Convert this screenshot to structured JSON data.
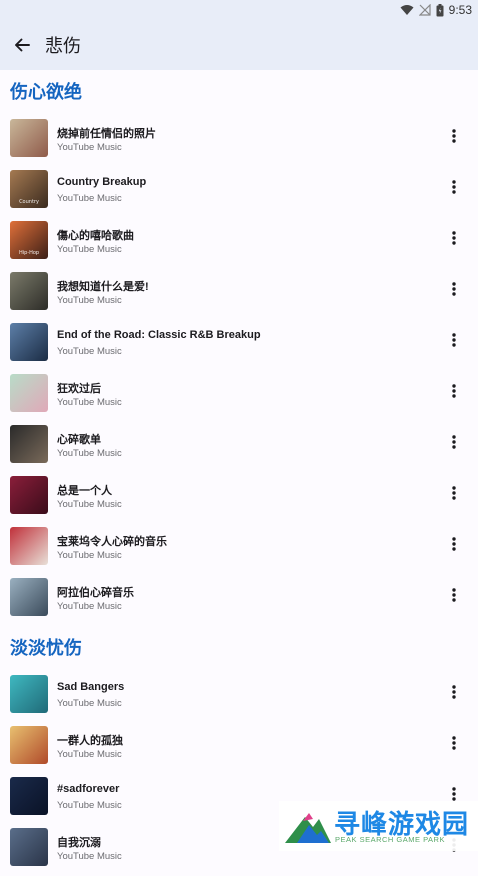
{
  "status": {
    "time": "9:53"
  },
  "header": {
    "title": "悲伤"
  },
  "sections": [
    {
      "title": "伤心欲绝",
      "items": [
        {
          "title": "烧掉前任情侣的照片",
          "subtitle": "YouTube Music",
          "thumb_caption": "",
          "colors": [
            "#c9b79a",
            "#8f5a4a"
          ]
        },
        {
          "title": "Country Breakup",
          "subtitle": "YouTube Music",
          "thumb_caption": "Country",
          "colors": [
            "#a57a52",
            "#3a2a1e"
          ]
        },
        {
          "title": "傷心的嘻哈歌曲",
          "subtitle": "YouTube Music",
          "thumb_caption": "Hip-Hop",
          "colors": [
            "#e0703a",
            "#3b1e16"
          ]
        },
        {
          "title": "我想知道什么是爱!",
          "subtitle": "YouTube Music",
          "thumb_caption": "",
          "colors": [
            "#7b7a6a",
            "#2d2d28"
          ]
        },
        {
          "title": "End of the Road: Classic R&B Breakup",
          "subtitle": "YouTube Music",
          "thumb_caption": "",
          "colors": [
            "#5d7fa8",
            "#1b2c44"
          ]
        },
        {
          "title": "狂欢过后",
          "subtitle": "YouTube Music",
          "thumb_caption": "",
          "colors": [
            "#b8dcc8",
            "#e0a8b8"
          ]
        },
        {
          "title": "心碎歌单",
          "subtitle": "YouTube Music",
          "thumb_caption": "",
          "colors": [
            "#2a2a2a",
            "#7a6a5a"
          ]
        },
        {
          "title": "总是一个人",
          "subtitle": "YouTube Music",
          "thumb_caption": "",
          "colors": [
            "#8a1e3a",
            "#3a0c1a"
          ]
        },
        {
          "title": "宝莱坞令人心碎的音乐",
          "subtitle": "YouTube Music",
          "thumb_caption": "",
          "colors": [
            "#c0303a",
            "#e8e0d8"
          ]
        },
        {
          "title": "阿拉伯心碎音乐",
          "subtitle": "YouTube Music",
          "thumb_caption": "",
          "colors": [
            "#9ab0c0",
            "#3a4a5a"
          ]
        }
      ]
    },
    {
      "title": "淡淡忧伤",
      "items": [
        {
          "title": "Sad Bangers",
          "subtitle": "YouTube Music",
          "thumb_caption": "",
          "colors": [
            "#3fb8c0",
            "#206a78"
          ]
        },
        {
          "title": "一群人的孤独",
          "subtitle": "YouTube Music",
          "thumb_caption": "",
          "colors": [
            "#e8c070",
            "#b04a2a"
          ]
        },
        {
          "title": "#sadforever",
          "subtitle": "YouTube Music",
          "thumb_caption": "",
          "colors": [
            "#1a2a4a",
            "#0a1226"
          ]
        },
        {
          "title": "自我沉溺",
          "subtitle": "YouTube Music",
          "thumb_caption": "",
          "colors": [
            "#5a6e8a",
            "#2a3448"
          ]
        }
      ]
    }
  ],
  "watermark": {
    "text": "寻峰游戏园",
    "sub": "PEAK SEARCH GAME PARK"
  }
}
